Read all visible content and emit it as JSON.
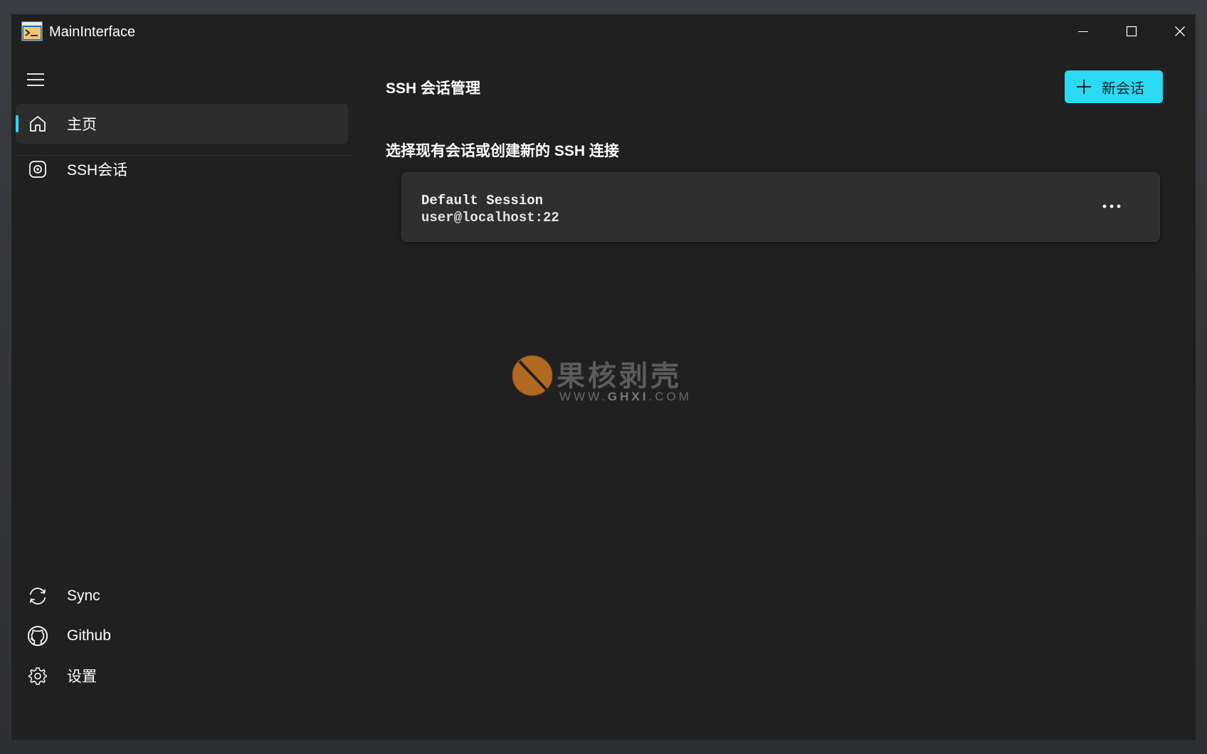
{
  "window": {
    "title": "MainInterface"
  },
  "sidebar": {
    "items": [
      {
        "label": "主页",
        "icon": "home-icon",
        "active": true
      },
      {
        "label": "SSH会话",
        "icon": "ssh-icon",
        "active": false
      }
    ],
    "footer_items": [
      {
        "label": "Sync",
        "icon": "sync-icon"
      },
      {
        "label": "Github",
        "icon": "github-icon"
      },
      {
        "label": "设置",
        "icon": "gear-icon"
      }
    ]
  },
  "main": {
    "title": "SSH 会话管理",
    "new_session_label": "新会话",
    "subtitle": "选择现有会话或创建新的 SSH 连接",
    "sessions": [
      {
        "name": "Default Session",
        "host": "user@localhost:22"
      }
    ]
  },
  "watermark": {
    "title": "果核剥壳",
    "url_prefix": "WWW.",
    "url_main": "GHXI",
    "url_suffix": ".COM"
  },
  "colors": {
    "accent": "#2ad9f2",
    "background": "#202020",
    "active_item": "#2d2d2d",
    "card": "#2f2f2f"
  }
}
